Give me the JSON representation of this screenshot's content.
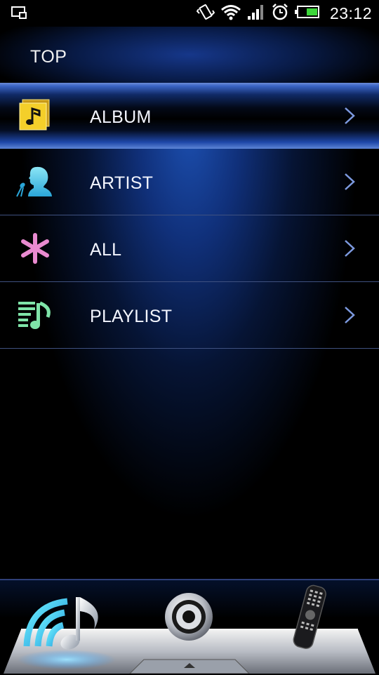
{
  "statusbar": {
    "time": "23:12"
  },
  "header": {
    "title": "TOP"
  },
  "menu": {
    "items": [
      {
        "label": "ALBUM",
        "icon": "album-icon",
        "selected": true
      },
      {
        "label": "ARTIST",
        "icon": "artist-icon",
        "selected": false
      },
      {
        "label": "ALL",
        "icon": "all-icon",
        "selected": false
      },
      {
        "label": "PLAYLIST",
        "icon": "playlist-icon",
        "selected": false
      }
    ]
  },
  "dock": {
    "buttons": [
      "music-wifi-icon",
      "speaker-icon",
      "remote-control-icon"
    ]
  },
  "colors": {
    "accent_blue": "#3a64c4",
    "chevron": "#7d9ae0",
    "album_yellow": "#f4cf2a",
    "artist_cyan": "#38c6e6",
    "all_pink": "#e98ad0",
    "playlist_green": "#7fe4a8"
  }
}
